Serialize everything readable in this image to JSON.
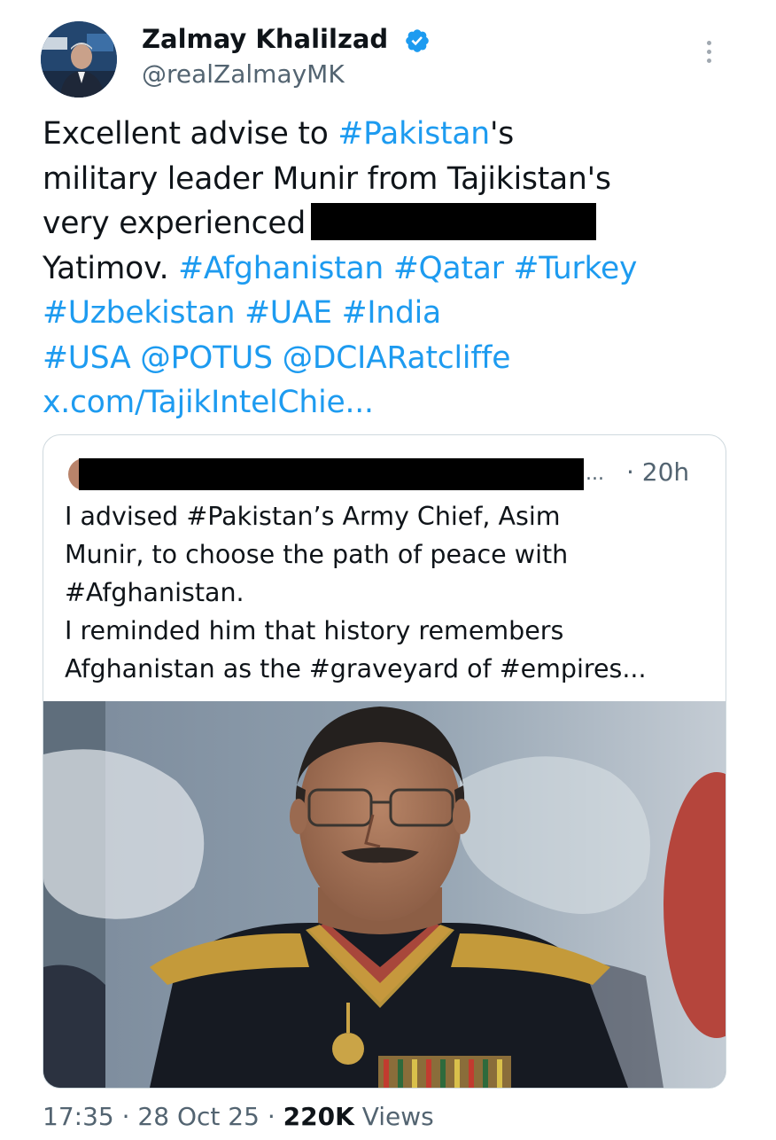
{
  "author": {
    "display_name": "Zalmay Khalilzad",
    "handle": "@realZalmayMK",
    "verified": true,
    "verified_icon": "verified-badge-icon",
    "avatar_icon": "profile-photo"
  },
  "menu_icon": "more-options-icon",
  "tweet": {
    "line1": {
      "a": "Excellent advise to ",
      "b": "#Pakistan",
      "c": "'s"
    },
    "line2": "military leader Munir from Tajikistan's",
    "line3": "very experienced",
    "line4": {
      "a": "Yatimov. ",
      "b": "#Afghanistan",
      "c": "#Qatar",
      "d": "#Turkey"
    },
    "line5": {
      "a": "#Uzbekistan",
      "b": "#UAE",
      "c": "#India"
    },
    "line6": {
      "a": "#USA",
      "b": "@POTUS",
      "c": "@DCIARatcliffe"
    },
    "line7": "x.com/TajikIntelChie..."
  },
  "quote": {
    "name_truncation": "...",
    "time": "· 20h",
    "lines": [
      "I advised #Pakistan’s Army Chief, Asim",
      "Munir, to choose the path of peace with",
      "#Afghanistan.",
      "I reminded him that history remembers",
      "Afghanistan as the #graveyard of #empires..."
    ],
    "media": "photo-of-uniformed-officer"
  },
  "meta": {
    "time": "17:35",
    "date": "28 Oct 25",
    "views_count": "220K",
    "views_label": "Views",
    "separator": "·"
  },
  "colors": {
    "link": "#1d9bf0",
    "text": "#0f1419",
    "secondary": "#536471",
    "border": "#cfd9de"
  }
}
